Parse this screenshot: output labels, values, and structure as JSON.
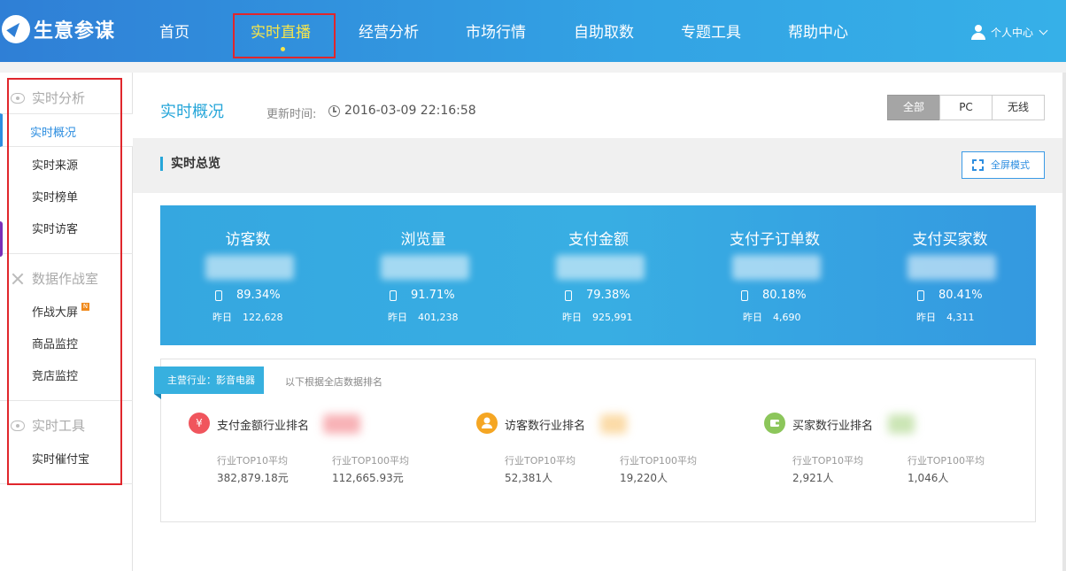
{
  "header": {
    "logo_text": "生意参谋",
    "nav": [
      "首页",
      "实时直播",
      "经营分析",
      "市场行情",
      "自助取数",
      "专题工具",
      "帮助中心"
    ],
    "active_nav": "实时直播",
    "user_label": "个人中心"
  },
  "sidebar": {
    "group1": "实时分析",
    "active_item": "实时概况",
    "group1_items": [
      "实时来源",
      "实时榜单",
      "实时访客"
    ],
    "group2": "数据作战室",
    "group2_items": [
      "作战大屏",
      "商品监控",
      "竞店监控"
    ],
    "new_badge": "N",
    "group3": "实时工具",
    "group3_items": [
      "实时催付宝"
    ]
  },
  "main": {
    "title": "实时概况",
    "update_label": "更新时间:",
    "update_time": "2016-03-09 22:16:58",
    "segments": [
      "全部",
      "PC",
      "无线"
    ],
    "active_segment": "全部",
    "overview_title": "实时总览",
    "fullscreen_label": "全屏模式"
  },
  "stats": [
    {
      "label": "访客数",
      "mobile_pct": "89.34%",
      "yesterday_label": "昨日",
      "yesterday": "122,628"
    },
    {
      "label": "浏览量",
      "mobile_pct": "91.71%",
      "yesterday_label": "昨日",
      "yesterday": "401,238"
    },
    {
      "label": "支付金额",
      "mobile_pct": "79.38%",
      "yesterday_label": "昨日",
      "yesterday": "925,991"
    },
    {
      "label": "支付子订单数",
      "mobile_pct": "80.18%",
      "yesterday_label": "昨日",
      "yesterday": "4,690"
    },
    {
      "label": "支付买家数",
      "mobile_pct": "80.41%",
      "yesterday_label": "昨日",
      "yesterday": "4,311"
    }
  ],
  "ranking": {
    "industry_tag": "主营行业：影音电器",
    "note": "以下根据全店数据排名",
    "items": [
      {
        "icon": "yen-icon",
        "icon_char": "¥",
        "color": "#f0555d",
        "title": "支付金额行业排名",
        "top10_label": "行业TOP10平均",
        "top10": "382,879.18元",
        "top100_label": "行业TOP100平均",
        "top100": "112,665.93元"
      },
      {
        "icon": "person-icon",
        "icon_char": "",
        "color": "#f5a623",
        "title": "访客数行业排名",
        "top10_label": "行业TOP10平均",
        "top10": "52,381人",
        "top100_label": "行业TOP100平均",
        "top100": "19,220人"
      },
      {
        "icon": "wallet-icon",
        "icon_char": "",
        "color": "#8cc65b",
        "title": "买家数行业排名",
        "top10_label": "行业TOP10平均",
        "top10": "2,921人",
        "top100_label": "行业TOP100平均",
        "top100": "1,046人"
      }
    ]
  }
}
